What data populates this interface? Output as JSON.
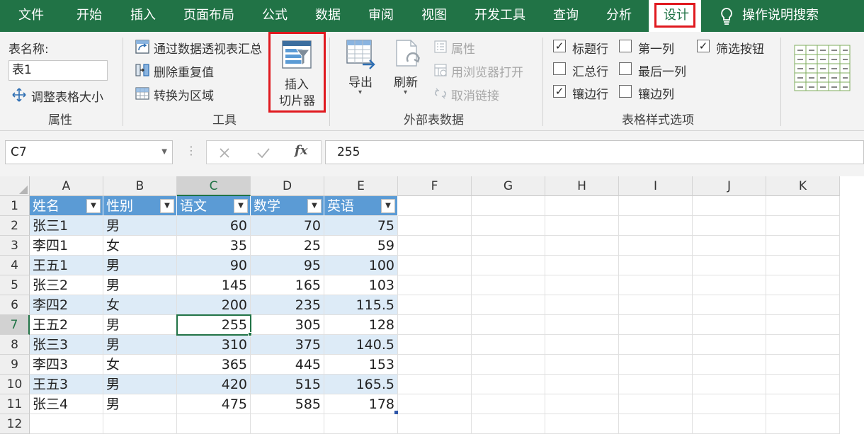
{
  "menu": {
    "tabs": [
      "文件",
      "开始",
      "插入",
      "页面布局",
      "公式",
      "数据",
      "审阅",
      "视图",
      "开发工具",
      "查询",
      "分析",
      "设计"
    ],
    "search_label": "操作说明搜索",
    "active": "设计"
  },
  "ribbon": {
    "props": {
      "table_name_label": "表名称:",
      "table_name_value": "表1",
      "resize_label": "调整表格大小",
      "group": "属性"
    },
    "tools": {
      "pivot": "通过数据透视表汇总",
      "dedupe": "删除重复值",
      "convert": "转换为区域",
      "slicer_line1": "插入",
      "slicer_line2": "切片器",
      "group": "工具"
    },
    "external": {
      "export": "导出",
      "refresh": "刷新",
      "properties": "属性",
      "open_browser": "用浏览器打开",
      "unlink": "取消链接",
      "group": "外部表数据"
    },
    "style_options": {
      "header_row": "标题行",
      "first_col": "第一列",
      "filter_btn": "筛选按钮",
      "total_row": "汇总行",
      "last_col": "最后一列",
      "banded_rows": "镶边行",
      "banded_cols": "镶边列",
      "group": "表格样式选项",
      "checked": {
        "header_row": true,
        "first_col": false,
        "filter_btn": true,
        "total_row": false,
        "last_col": false,
        "banded_rows": true,
        "banded_cols": false
      }
    }
  },
  "formula_bar": {
    "name_box": "C7",
    "formula": "255"
  },
  "grid": {
    "columns": [
      "A",
      "B",
      "C",
      "D",
      "E",
      "F",
      "G",
      "H",
      "I",
      "J",
      "K"
    ],
    "rows": [
      "1",
      "2",
      "3",
      "4",
      "5",
      "6",
      "7",
      "8",
      "9",
      "10",
      "11",
      "12"
    ],
    "selected_col": "C",
    "selected_row": "7",
    "table_headers": [
      "姓名",
      "性别",
      "语文",
      "数学",
      "英语"
    ],
    "table_rows": [
      [
        "张三1",
        "男",
        "60",
        "70",
        "75"
      ],
      [
        "李四1",
        "女",
        "35",
        "25",
        "59"
      ],
      [
        "王五1",
        "男",
        "90",
        "95",
        "100"
      ],
      [
        "张三2",
        "男",
        "145",
        "165",
        "103"
      ],
      [
        "李四2",
        "女",
        "200",
        "235",
        "115.5"
      ],
      [
        "王五2",
        "男",
        "255",
        "305",
        "128"
      ],
      [
        "张三3",
        "男",
        "310",
        "375",
        "140.5"
      ],
      [
        "李四3",
        "女",
        "365",
        "445",
        "153"
      ],
      [
        "王五3",
        "男",
        "420",
        "515",
        "165.5"
      ],
      [
        "张三4",
        "男",
        "475",
        "585",
        "178"
      ]
    ]
  },
  "colors": {
    "excel_green": "#217346",
    "table_header": "#5b9bd5",
    "band": "#ddebf7",
    "highlight_red": "#e0191f"
  }
}
